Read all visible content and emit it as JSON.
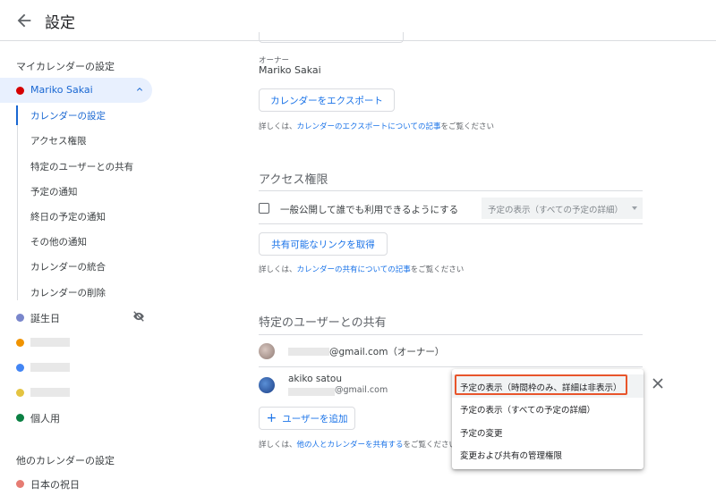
{
  "header": {
    "title": "設定",
    "back_icon": "arrow-back-icon"
  },
  "sidebar": {
    "my_calendars_label": "マイカレンダーの設定",
    "active_calendar": {
      "name": "Mariko Sakai",
      "color": "#d50000"
    },
    "subitems": [
      "カレンダーの設定",
      "アクセス権限",
      "特定のユーザーとの共有",
      "予定の通知",
      "終日の予定の通知",
      "その他の通知",
      "カレンダーの統合",
      "カレンダーの削除"
    ],
    "calendars": [
      {
        "name": "誕生日",
        "color": "#7986cb",
        "hidden_icon": "visibility-off-icon"
      },
      {
        "name": "",
        "color": "#f09300"
      },
      {
        "name": "",
        "color": "#4285f4"
      },
      {
        "name": "",
        "color": "#e4c441"
      },
      {
        "name": "個人用",
        "color": "#0b8043"
      }
    ],
    "other_calendars_label": "他のカレンダーの設定",
    "other_calendars": [
      {
        "name": "日本の祝日",
        "color": "#e67c73"
      }
    ]
  },
  "main": {
    "owner_label": "オーナー",
    "owner_name": "Mariko Sakai",
    "export_button": "カレンダーをエクスポート",
    "export_note_prefix": "詳しくは、",
    "export_note_link": "カレンダーのエクスポートについての記事",
    "export_note_suffix": "をご覧ください",
    "access_heading": "アクセス権限",
    "public_checkbox_label": "一般公開して誰でも利用できるようにする",
    "public_select_value": "予定の表示（すべての予定の詳細）",
    "share_link_button": "共有可能なリンクを取得",
    "share_note_prefix": "詳しくは、",
    "share_note_link": "カレンダーの共有についての記事",
    "share_note_suffix": "をご覧ください",
    "sharing_heading": "特定のユーザーとの共有",
    "owner_row": {
      "email_suffix": "@gmail.com（オーナー）"
    },
    "user_row": {
      "name": "akiko satou",
      "email_suffix": "@gmail.com"
    },
    "add_user_button": "ユーザーを追加",
    "add_note_prefix": "詳しくは、",
    "add_note_link": "他の人とカレンダーを共有する",
    "add_note_suffix": "をご覧ください"
  },
  "permission_menu": {
    "items": [
      "予定の表示（時間枠のみ、詳細は非表示）",
      "予定の表示（すべての予定の詳細）",
      "予定の変更",
      "変更および共有の管理権限"
    ],
    "highlighted_index": 0
  },
  "colors": {
    "accent": "#1a73e8",
    "active_bg": "#e8f0fe",
    "highlight_box": "#e8552b"
  }
}
